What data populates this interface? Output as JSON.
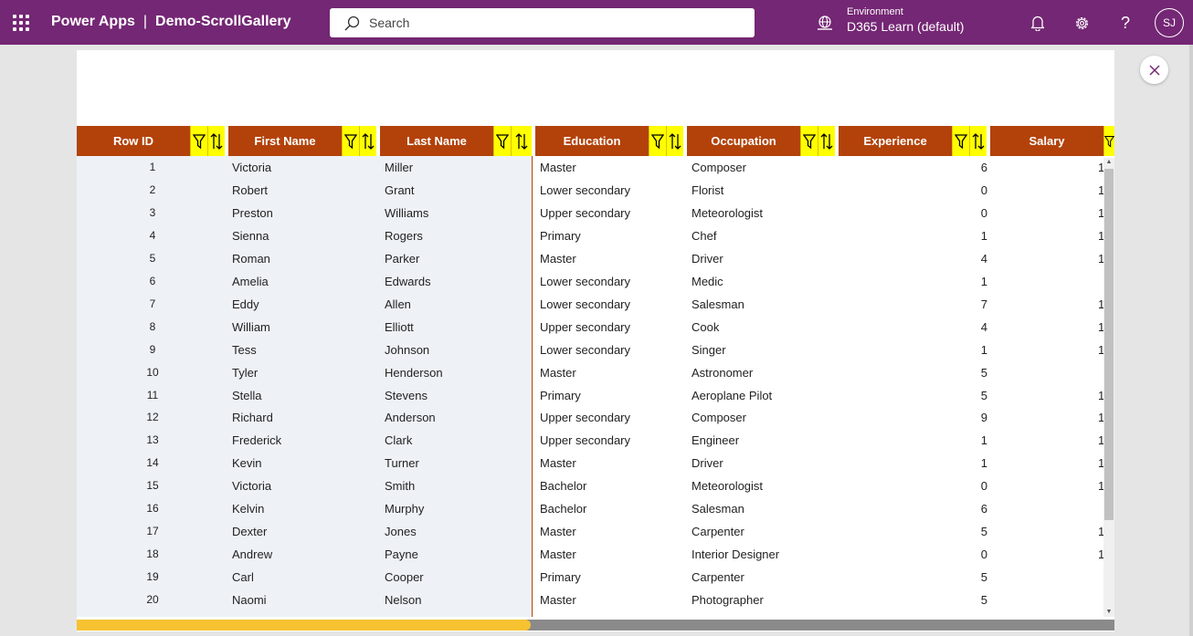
{
  "app": {
    "name": "Power Apps",
    "separator": "|",
    "app_name": "Demo-ScrollGallery"
  },
  "search": {
    "placeholder": "Search"
  },
  "environment": {
    "label": "Environment",
    "value": "D365 Learn (default)"
  },
  "user": {
    "initials": "SJ"
  },
  "help_label": "?",
  "colors": {
    "brand": "#742774",
    "header": "#b3420a",
    "filter_button": "#ffff00",
    "scroll_thumb": "#f6c230"
  },
  "icons": [
    "waffle-icon",
    "search-icon",
    "environment-icon",
    "bell-icon",
    "gear-icon",
    "help-icon",
    "close-icon",
    "filter-icon",
    "sort-icon"
  ],
  "columns": [
    "Row ID",
    "First Name",
    "Last Name",
    "Education",
    "Occupation",
    "Experience",
    "Salary"
  ],
  "rows": [
    {
      "id": "1",
      "first": "Victoria",
      "last": "Miller",
      "education": "Master",
      "occupation": "Composer",
      "experience": "6",
      "salary": "1"
    },
    {
      "id": "2",
      "first": "Robert",
      "last": "Grant",
      "education": "Lower secondary",
      "occupation": "Florist",
      "experience": "0",
      "salary": "1"
    },
    {
      "id": "3",
      "first": "Preston",
      "last": "Williams",
      "education": "Upper secondary",
      "occupation": "Meteorologist",
      "experience": "0",
      "salary": "1"
    },
    {
      "id": "4",
      "first": "Sienna",
      "last": "Rogers",
      "education": "Primary",
      "occupation": "Chef",
      "experience": "1",
      "salary": "1"
    },
    {
      "id": "5",
      "first": "Roman",
      "last": "Parker",
      "education": "Master",
      "occupation": "Driver",
      "experience": "4",
      "salary": "1"
    },
    {
      "id": "6",
      "first": "Amelia",
      "last": "Edwards",
      "education": "Lower secondary",
      "occupation": "Medic",
      "experience": "1",
      "salary": ""
    },
    {
      "id": "7",
      "first": "Eddy",
      "last": "Allen",
      "education": "Lower secondary",
      "occupation": "Salesman",
      "experience": "7",
      "salary": "1"
    },
    {
      "id": "8",
      "first": "William",
      "last": "Elliott",
      "education": "Upper secondary",
      "occupation": "Cook",
      "experience": "4",
      "salary": "1"
    },
    {
      "id": "9",
      "first": "Tess",
      "last": "Johnson",
      "education": "Lower secondary",
      "occupation": "Singer",
      "experience": "1",
      "salary": "1"
    },
    {
      "id": "10",
      "first": "Tyler",
      "last": "Henderson",
      "education": "Master",
      "occupation": "Astronomer",
      "experience": "5",
      "salary": ""
    },
    {
      "id": "11",
      "first": "Stella",
      "last": "Stevens",
      "education": "Primary",
      "occupation": "Aeroplane Pilot",
      "experience": "5",
      "salary": "1"
    },
    {
      "id": "12",
      "first": "Richard",
      "last": "Anderson",
      "education": "Upper secondary",
      "occupation": "Composer",
      "experience": "9",
      "salary": "1"
    },
    {
      "id": "13",
      "first": "Frederick",
      "last": "Clark",
      "education": "Upper secondary",
      "occupation": "Engineer",
      "experience": "1",
      "salary": "1"
    },
    {
      "id": "14",
      "first": "Kevin",
      "last": "Turner",
      "education": "Master",
      "occupation": "Driver",
      "experience": "1",
      "salary": "1"
    },
    {
      "id": "15",
      "first": "Victoria",
      "last": "Smith",
      "education": "Bachelor",
      "occupation": "Meteorologist",
      "experience": "0",
      "salary": "1"
    },
    {
      "id": "16",
      "first": "Kelvin",
      "last": "Murphy",
      "education": "Bachelor",
      "occupation": "Salesman",
      "experience": "6",
      "salary": ""
    },
    {
      "id": "17",
      "first": "Dexter",
      "last": "Jones",
      "education": "Master",
      "occupation": "Carpenter",
      "experience": "5",
      "salary": "1"
    },
    {
      "id": "18",
      "first": "Andrew",
      "last": "Payne",
      "education": "Master",
      "occupation": "Interior Designer",
      "experience": "0",
      "salary": "1"
    },
    {
      "id": "19",
      "first": "Carl",
      "last": "Cooper",
      "education": "Primary",
      "occupation": "Carpenter",
      "experience": "5",
      "salary": ""
    },
    {
      "id": "20",
      "first": "Naomi",
      "last": "Nelson",
      "education": "Master",
      "occupation": "Photographer",
      "experience": "5",
      "salary": ""
    }
  ]
}
